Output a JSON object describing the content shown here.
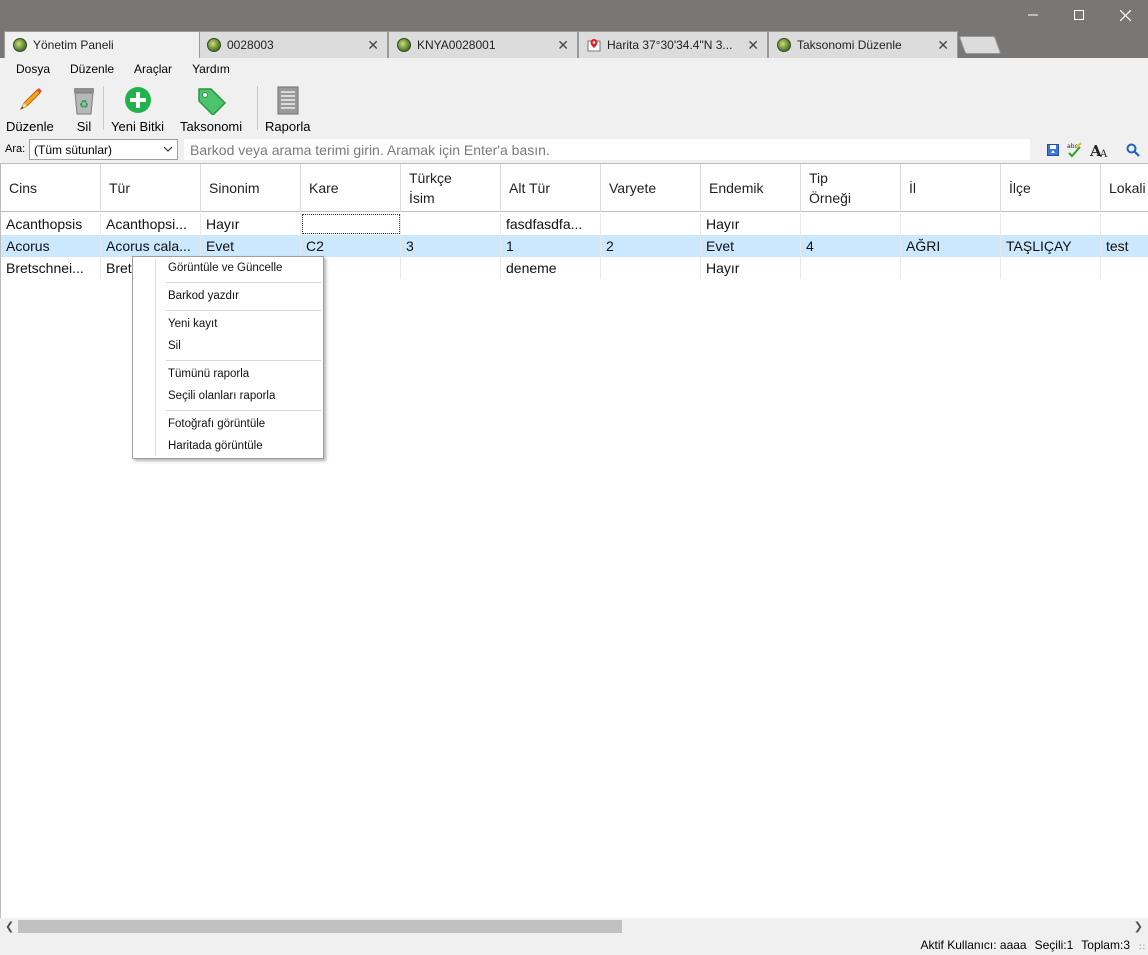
{
  "tabs": [
    {
      "label": "Yönetim Paneli",
      "icon": "globe-icon",
      "active": true
    },
    {
      "label": "0028003",
      "icon": "globe-icon",
      "close": "✕"
    },
    {
      "label": "KNYA0028001",
      "icon": "globe-icon",
      "close": "✕"
    },
    {
      "label": "Harita 37°30'34.4\"N 3...",
      "icon": "map-pin-icon",
      "close": "✕"
    },
    {
      "label": "Taksonomi Düzenle",
      "icon": "globe-icon",
      "close": "✕"
    }
  ],
  "menubar": [
    "Dosya",
    "Düzenle",
    "Araçlar",
    "Yardım"
  ],
  "toolbar": {
    "edit": "Düzenle",
    "delete": "Sil",
    "new_plant": "Yeni Bitki",
    "taxonomy": "Taksonomi",
    "report": "Raporla"
  },
  "search": {
    "label": "Ara:",
    "column_select": "(Tüm sütunlar)",
    "placeholder": "Barkod veya arama terimi girin. Aramak için Enter'a basın."
  },
  "table": {
    "headers": [
      "Cins",
      "Tür",
      "Sinonim",
      "Kare",
      "Türkçe\nİsim",
      "Alt Tür",
      "Varyete",
      "Endemik",
      "Tip\nÖrneği",
      "İl",
      "İlçe",
      "Lokali"
    ],
    "rows": [
      [
        "Acanthopsis",
        "Acanthopsi...",
        "Hayır",
        "",
        "",
        "fasdfasdfa...",
        "",
        "Hayır",
        "",
        "",
        "",
        ""
      ],
      [
        "Acorus",
        "Acorus cala...",
        "Evet",
        "C2",
        "3",
        "1",
        "2",
        "Evet",
        "4",
        "AĞRI",
        "TAŞLIÇAY",
        "test"
      ],
      [
        "Bretschnei...",
        "Bret",
        "",
        "",
        "",
        "deneme",
        "",
        "Hayır",
        "",
        "",
        "",
        ""
      ]
    ]
  },
  "context_menu": {
    "view_update": "Görüntüle ve Güncelle",
    "print_barcode": "Barkod yazdır",
    "new_record": "Yeni kayıt",
    "delete": "Sil",
    "report_all": "Tümünü raporla",
    "report_selected": "Seçili olanları raporla",
    "view_photo": "Fotoğrafı görüntüle",
    "view_on_map": "Haritada görüntüle"
  },
  "status": {
    "active_user": "Aktif Kullanıcı: aaaa",
    "selected": "Seçili:1",
    "total": "Toplam:3"
  },
  "colors": {
    "titlebar": "#797676",
    "selection": "#cce8ff",
    "chrome": "#f0f0f0"
  }
}
